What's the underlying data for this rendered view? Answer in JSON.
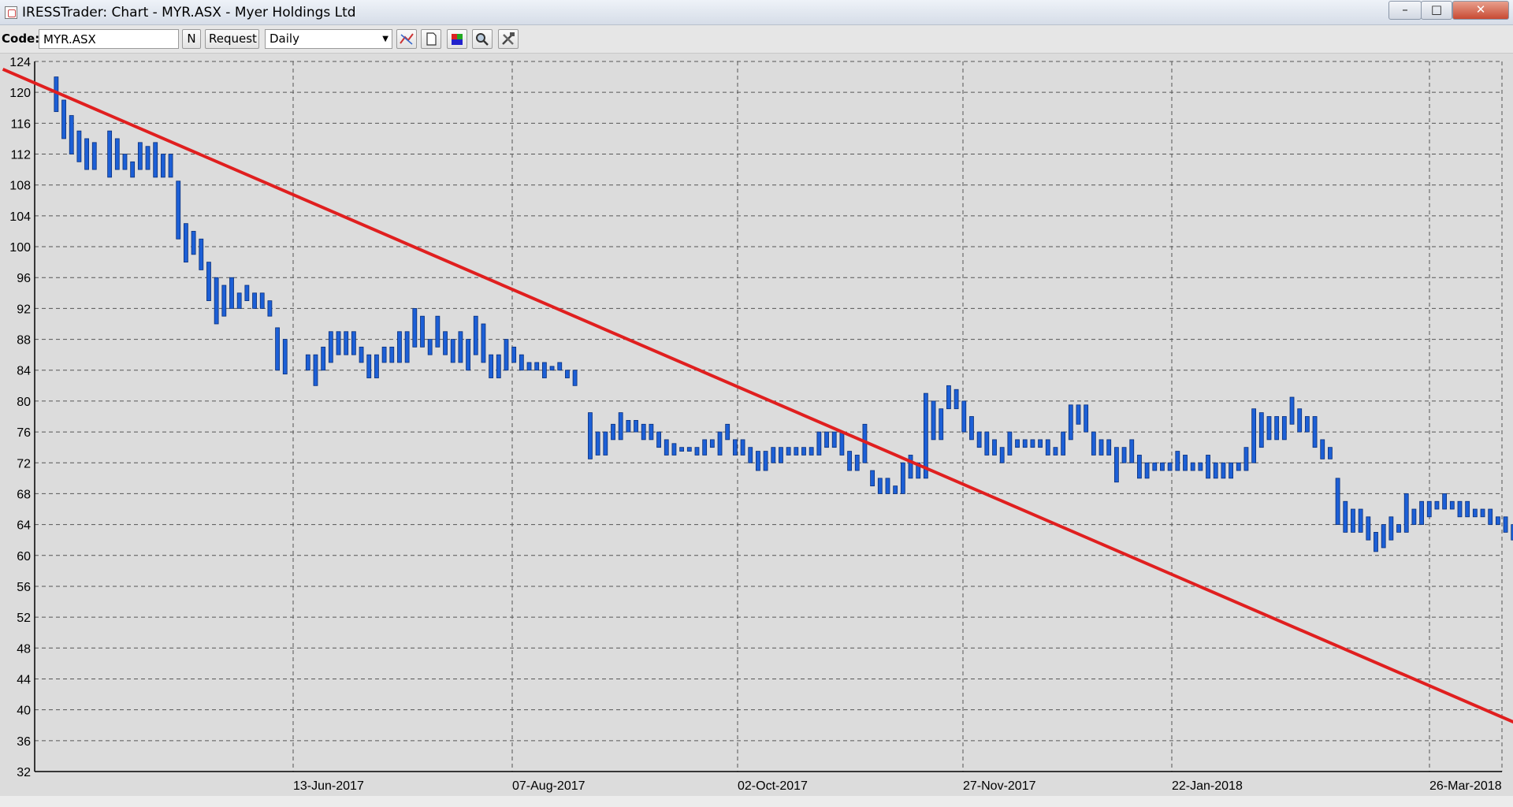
{
  "window": {
    "title": "IRESSTrader: Chart - MYR.ASX - Myer Holdings Ltd"
  },
  "toolbar": {
    "code_label": "Code:",
    "code_value": "MYR.ASX",
    "n_label": "N",
    "request_label": "Request",
    "period_value": "Daily"
  },
  "chart_data": {
    "type": "ohlc",
    "title": "",
    "xlabel": "",
    "ylabel": "",
    "ylim": [
      32,
      124
    ],
    "ytick_step": 4,
    "y_ticks": [
      32,
      36,
      40,
      44,
      48,
      52,
      56,
      60,
      64,
      68,
      72,
      76,
      80,
      84,
      88,
      92,
      96,
      100,
      104,
      108,
      112,
      116,
      120,
      124
    ],
    "x_tick_labels": [
      "13-Jun-2017",
      "07-Aug-2017",
      "02-Oct-2017",
      "27-Nov-2017",
      "22-Jan-2018",
      "26-Mar-2018"
    ],
    "grid": true,
    "bar_color": "#1c5fd6",
    "trend_color": "#e01f1f",
    "x_range_bars": [
      0,
      195
    ],
    "trendline": {
      "start": [
        -5,
        123
      ],
      "end": [
        194,
        38
      ]
    },
    "bars": [
      {
        "x": 2,
        "high": 122,
        "low": 117.5
      },
      {
        "x": 3,
        "high": 119,
        "low": 114
      },
      {
        "x": 4,
        "high": 117,
        "low": 112
      },
      {
        "x": 5,
        "high": 115,
        "low": 111
      },
      {
        "x": 6,
        "high": 114,
        "low": 110
      },
      {
        "x": 7,
        "high": 113.5,
        "low": 110
      },
      {
        "x": 9,
        "high": 115,
        "low": 109
      },
      {
        "x": 10,
        "high": 114,
        "low": 110
      },
      {
        "x": 11,
        "high": 112,
        "low": 110
      },
      {
        "x": 12,
        "high": 111,
        "low": 109
      },
      {
        "x": 13,
        "high": 113.5,
        "low": 110
      },
      {
        "x": 14,
        "high": 113,
        "low": 110
      },
      {
        "x": 15,
        "high": 113.5,
        "low": 109
      },
      {
        "x": 16,
        "high": 112,
        "low": 109
      },
      {
        "x": 17,
        "high": 112,
        "low": 109
      },
      {
        "x": 18,
        "high": 108.5,
        "low": 101
      },
      {
        "x": 19,
        "high": 103,
        "low": 98
      },
      {
        "x": 20,
        "high": 102,
        "low": 99
      },
      {
        "x": 21,
        "high": 101,
        "low": 97
      },
      {
        "x": 22,
        "high": 98,
        "low": 93
      },
      {
        "x": 23,
        "high": 96,
        "low": 90
      },
      {
        "x": 24,
        "high": 95,
        "low": 91
      },
      {
        "x": 25,
        "high": 96,
        "low": 92
      },
      {
        "x": 26,
        "high": 94,
        "low": 92
      },
      {
        "x": 27,
        "high": 95,
        "low": 93
      },
      {
        "x": 28,
        "high": 94,
        "low": 92
      },
      {
        "x": 29,
        "high": 94,
        "low": 92
      },
      {
        "x": 30,
        "high": 93,
        "low": 91
      },
      {
        "x": 31,
        "high": 89.5,
        "low": 84
      },
      {
        "x": 32,
        "high": 88,
        "low": 83.5
      },
      {
        "x": 35,
        "high": 86,
        "low": 84
      },
      {
        "x": 36,
        "high": 86,
        "low": 82
      },
      {
        "x": 37,
        "high": 87,
        "low": 84
      },
      {
        "x": 38,
        "high": 89,
        "low": 85
      },
      {
        "x": 39,
        "high": 89,
        "low": 86
      },
      {
        "x": 40,
        "high": 89,
        "low": 86
      },
      {
        "x": 41,
        "high": 89,
        "low": 86
      },
      {
        "x": 42,
        "high": 87,
        "low": 85
      },
      {
        "x": 43,
        "high": 86,
        "low": 83
      },
      {
        "x": 44,
        "high": 86,
        "low": 83
      },
      {
        "x": 45,
        "high": 87,
        "low": 85
      },
      {
        "x": 46,
        "high": 87,
        "low": 85
      },
      {
        "x": 47,
        "high": 89,
        "low": 85
      },
      {
        "x": 48,
        "high": 89,
        "low": 85
      },
      {
        "x": 49,
        "high": 92,
        "low": 87
      },
      {
        "x": 50,
        "high": 91,
        "low": 87
      },
      {
        "x": 51,
        "high": 88,
        "low": 86
      },
      {
        "x": 52,
        "high": 91,
        "low": 87
      },
      {
        "x": 53,
        "high": 89,
        "low": 86
      },
      {
        "x": 54,
        "high": 88,
        "low": 85
      },
      {
        "x": 55,
        "high": 89,
        "low": 85
      },
      {
        "x": 56,
        "high": 88,
        "low": 84
      },
      {
        "x": 57,
        "high": 91,
        "low": 86
      },
      {
        "x": 58,
        "high": 90,
        "low": 85
      },
      {
        "x": 59,
        "high": 86,
        "low": 83
      },
      {
        "x": 60,
        "high": 86,
        "low": 83
      },
      {
        "x": 61,
        "high": 88,
        "low": 84
      },
      {
        "x": 62,
        "high": 87,
        "low": 85
      },
      {
        "x": 63,
        "high": 86,
        "low": 84
      },
      {
        "x": 64,
        "high": 85,
        "low": 84
      },
      {
        "x": 65,
        "high": 85,
        "low": 84
      },
      {
        "x": 66,
        "high": 85,
        "low": 83
      },
      {
        "x": 67,
        "high": 84.5,
        "low": 84
      },
      {
        "x": 68,
        "high": 85,
        "low": 84
      },
      {
        "x": 69,
        "high": 84,
        "low": 83
      },
      {
        "x": 70,
        "high": 84,
        "low": 82
      },
      {
        "x": 72,
        "high": 78.5,
        "low": 72.5
      },
      {
        "x": 73,
        "high": 76,
        "low": 73
      },
      {
        "x": 74,
        "high": 76,
        "low": 73
      },
      {
        "x": 75,
        "high": 77,
        "low": 75
      },
      {
        "x": 76,
        "high": 78.5,
        "low": 75
      },
      {
        "x": 77,
        "high": 77.5,
        "low": 76
      },
      {
        "x": 78,
        "high": 77.5,
        "low": 76
      },
      {
        "x": 79,
        "high": 77,
        "low": 75
      },
      {
        "x": 80,
        "high": 77,
        "low": 75
      },
      {
        "x": 81,
        "high": 76,
        "low": 74
      },
      {
        "x": 82,
        "high": 75,
        "low": 73
      },
      {
        "x": 83,
        "high": 74.5,
        "low": 73
      },
      {
        "x": 84,
        "high": 74,
        "low": 73.5
      },
      {
        "x": 85,
        "high": 74,
        "low": 73.5
      },
      {
        "x": 86,
        "high": 74,
        "low": 73
      },
      {
        "x": 87,
        "high": 75,
        "low": 73
      },
      {
        "x": 88,
        "high": 75,
        "low": 74
      },
      {
        "x": 89,
        "high": 76,
        "low": 73
      },
      {
        "x": 90,
        "high": 77,
        "low": 75
      },
      {
        "x": 91,
        "high": 75,
        "low": 73
      },
      {
        "x": 92,
        "high": 75,
        "low": 73
      },
      {
        "x": 93,
        "high": 74,
        "low": 72
      },
      {
        "x": 94,
        "high": 73.5,
        "low": 71
      },
      {
        "x": 95,
        "high": 73.5,
        "low": 71
      },
      {
        "x": 96,
        "high": 74,
        "low": 72
      },
      {
        "x": 97,
        "high": 74,
        "low": 72
      },
      {
        "x": 98,
        "high": 74,
        "low": 73
      },
      {
        "x": 99,
        "high": 74,
        "low": 73
      },
      {
        "x": 100,
        "high": 74,
        "low": 73
      },
      {
        "x": 101,
        "high": 74,
        "low": 73
      },
      {
        "x": 102,
        "high": 76,
        "low": 73
      },
      {
        "x": 103,
        "high": 76,
        "low": 74
      },
      {
        "x": 104,
        "high": 76,
        "low": 74
      },
      {
        "x": 105,
        "high": 76,
        "low": 73
      },
      {
        "x": 106,
        "high": 73.5,
        "low": 71
      },
      {
        "x": 107,
        "high": 73,
        "low": 71
      },
      {
        "x": 108,
        "high": 77,
        "low": 72
      },
      {
        "x": 109,
        "high": 71,
        "low": 69
      },
      {
        "x": 110,
        "high": 70,
        "low": 68
      },
      {
        "x": 111,
        "high": 70,
        "low": 68
      },
      {
        "x": 112,
        "high": 69,
        "low": 68
      },
      {
        "x": 113,
        "high": 72,
        "low": 68
      },
      {
        "x": 114,
        "high": 73,
        "low": 70
      },
      {
        "x": 115,
        "high": 72,
        "low": 70
      },
      {
        "x": 116,
        "high": 81,
        "low": 70
      },
      {
        "x": 117,
        "high": 80,
        "low": 75
      },
      {
        "x": 118,
        "high": 79,
        "low": 75
      },
      {
        "x": 119,
        "high": 82,
        "low": 79
      },
      {
        "x": 120,
        "high": 81.5,
        "low": 79
      },
      {
        "x": 121,
        "high": 80,
        "low": 76
      },
      {
        "x": 122,
        "high": 78,
        "low": 75
      },
      {
        "x": 123,
        "high": 76,
        "low": 74
      },
      {
        "x": 124,
        "high": 76,
        "low": 73
      },
      {
        "x": 125,
        "high": 75,
        "low": 73
      },
      {
        "x": 126,
        "high": 74,
        "low": 72
      },
      {
        "x": 127,
        "high": 76,
        "low": 73
      },
      {
        "x": 128,
        "high": 75,
        "low": 74
      },
      {
        "x": 129,
        "high": 75,
        "low": 74
      },
      {
        "x": 130,
        "high": 75,
        "low": 74
      },
      {
        "x": 131,
        "high": 75,
        "low": 74
      },
      {
        "x": 132,
        "high": 75,
        "low": 73
      },
      {
        "x": 133,
        "high": 74,
        "low": 73
      },
      {
        "x": 134,
        "high": 76,
        "low": 73
      },
      {
        "x": 135,
        "high": 79.5,
        "low": 75
      },
      {
        "x": 136,
        "high": 79.5,
        "low": 77
      },
      {
        "x": 137,
        "high": 79.5,
        "low": 76
      },
      {
        "x": 138,
        "high": 76,
        "low": 73
      },
      {
        "x": 139,
        "high": 75,
        "low": 73
      },
      {
        "x": 140,
        "high": 75,
        "low": 73
      },
      {
        "x": 141,
        "high": 74,
        "low": 69.5
      },
      {
        "x": 142,
        "high": 74,
        "low": 72
      },
      {
        "x": 143,
        "high": 75,
        "low": 72
      },
      {
        "x": 144,
        "high": 73,
        "low": 70
      },
      {
        "x": 145,
        "high": 72,
        "low": 70
      },
      {
        "x": 146,
        "high": 72,
        "low": 71
      },
      {
        "x": 147,
        "high": 72,
        "low": 71
      },
      {
        "x": 148,
        "high": 72,
        "low": 71
      },
      {
        "x": 149,
        "high": 73.5,
        "low": 71
      },
      {
        "x": 150,
        "high": 73,
        "low": 71
      },
      {
        "x": 151,
        "high": 72,
        "low": 71
      },
      {
        "x": 152,
        "high": 72,
        "low": 71
      },
      {
        "x": 153,
        "high": 73,
        "low": 70
      },
      {
        "x": 154,
        "high": 72,
        "low": 70
      },
      {
        "x": 155,
        "high": 72,
        "low": 70
      },
      {
        "x": 156,
        "high": 72,
        "low": 70
      },
      {
        "x": 157,
        "high": 72,
        "low": 71
      },
      {
        "x": 158,
        "high": 74,
        "low": 71
      },
      {
        "x": 159,
        "high": 79,
        "low": 72
      },
      {
        "x": 160,
        "high": 78.5,
        "low": 74
      },
      {
        "x": 161,
        "high": 78,
        "low": 75
      },
      {
        "x": 162,
        "high": 78,
        "low": 75
      },
      {
        "x": 163,
        "high": 78,
        "low": 75
      },
      {
        "x": 164,
        "high": 80.5,
        "low": 77
      },
      {
        "x": 165,
        "high": 79,
        "low": 76
      },
      {
        "x": 166,
        "high": 78,
        "low": 76
      },
      {
        "x": 167,
        "high": 78,
        "low": 74
      },
      {
        "x": 168,
        "high": 75,
        "low": 72.5
      },
      {
        "x": 169,
        "high": 74,
        "low": 72.5
      },
      {
        "x": 170,
        "high": 70,
        "low": 64
      },
      {
        "x": 171,
        "high": 67,
        "low": 63
      },
      {
        "x": 172,
        "high": 66,
        "low": 63
      },
      {
        "x": 173,
        "high": 66,
        "low": 63
      },
      {
        "x": 174,
        "high": 65,
        "low": 62
      },
      {
        "x": 175,
        "high": 63,
        "low": 60.5
      },
      {
        "x": 176,
        "high": 64,
        "low": 61
      },
      {
        "x": 177,
        "high": 65,
        "low": 62
      },
      {
        "x": 178,
        "high": 64,
        "low": 63
      },
      {
        "x": 179,
        "high": 68,
        "low": 63
      },
      {
        "x": 180,
        "high": 66,
        "low": 64
      },
      {
        "x": 181,
        "high": 67,
        "low": 64
      },
      {
        "x": 182,
        "high": 67,
        "low": 65
      },
      {
        "x": 183,
        "high": 67,
        "low": 66
      },
      {
        "x": 184,
        "high": 68,
        "low": 66
      },
      {
        "x": 185,
        "high": 67,
        "low": 66
      },
      {
        "x": 186,
        "high": 67,
        "low": 65
      },
      {
        "x": 187,
        "high": 67,
        "low": 65
      },
      {
        "x": 188,
        "high": 66,
        "low": 65
      },
      {
        "x": 189,
        "high": 66,
        "low": 65
      },
      {
        "x": 190,
        "high": 66,
        "low": 64
      },
      {
        "x": 191,
        "high": 65,
        "low": 64
      },
      {
        "x": 192,
        "high": 65,
        "low": 63
      },
      {
        "x": 193,
        "high": 64,
        "low": 62
      },
      {
        "x": 194,
        "high": 64,
        "low": 62
      },
      {
        "x": 195,
        "high": 64,
        "low": 62
      }
    ]
  }
}
